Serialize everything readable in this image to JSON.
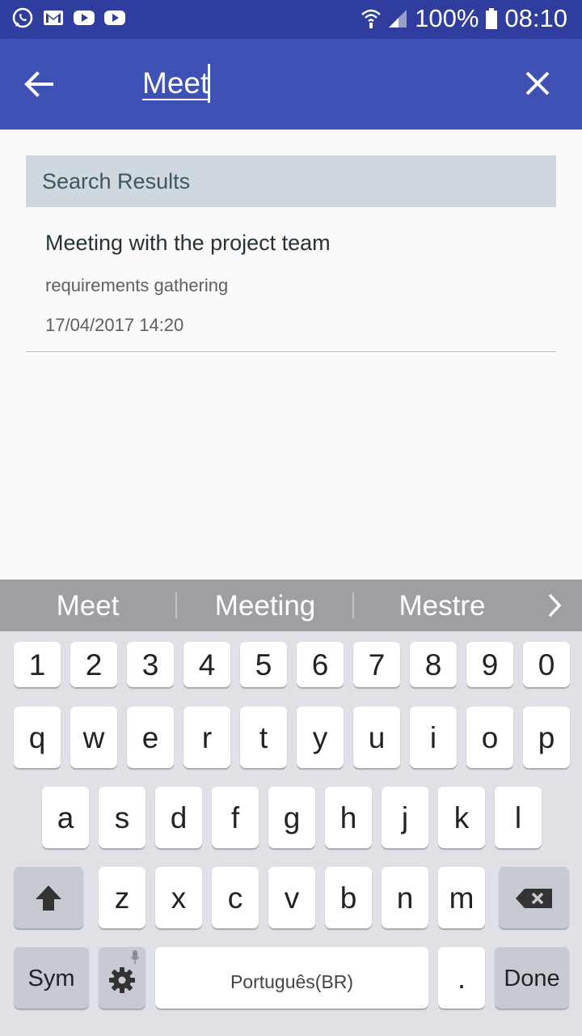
{
  "status_bar": {
    "battery": "100%",
    "time": "08:10",
    "notification_icons": [
      "whatsapp-icon",
      "gmail-icon",
      "youtube-icon",
      "youtube-icon"
    ]
  },
  "app_bar": {
    "search_value": "Meet"
  },
  "results": {
    "header": "Search Results",
    "items": [
      {
        "title": "Meeting with the project team",
        "description": "requirements gathering",
        "datetime": "17/04/2017 14:20"
      }
    ]
  },
  "keyboard": {
    "suggestions": [
      "Meet",
      "Meeting",
      "Mestre"
    ],
    "number_row": [
      "1",
      "2",
      "3",
      "4",
      "5",
      "6",
      "7",
      "8",
      "9",
      "0"
    ],
    "row1": [
      "q",
      "w",
      "e",
      "r",
      "t",
      "y",
      "u",
      "i",
      "o",
      "p"
    ],
    "row2": [
      "a",
      "s",
      "d",
      "f",
      "g",
      "h",
      "j",
      "k",
      "l"
    ],
    "row3": [
      "z",
      "x",
      "c",
      "v",
      "b",
      "n",
      "m"
    ],
    "sym_label": "Sym",
    "space_label": "Português(BR)",
    "period_label": ".",
    "done_label": "Done"
  }
}
